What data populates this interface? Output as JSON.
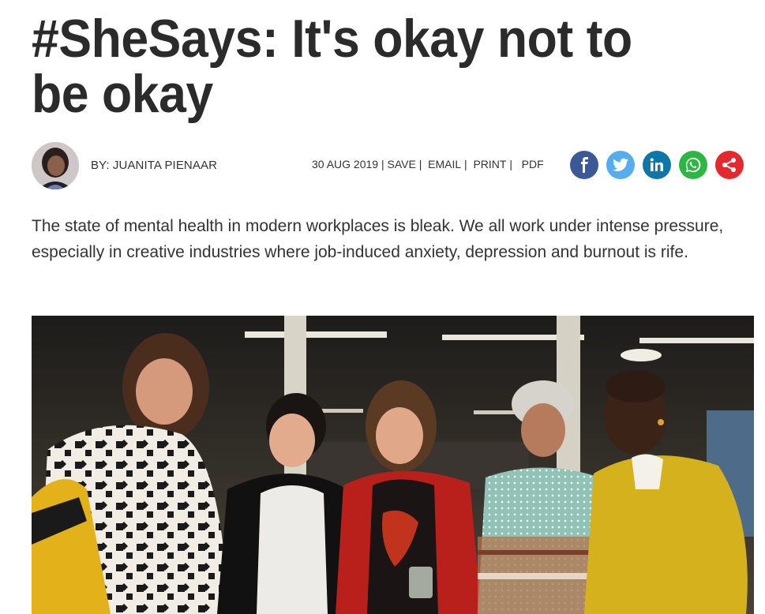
{
  "article": {
    "headline": "#SheSays: It's okay not to be okay",
    "author": "BY: JUANITA PIENAAR",
    "date": "30 AUG 2019",
    "actions": {
      "save": "SAVE",
      "email": "EMAIL",
      "print": "PRINT",
      "pdf": "PDF"
    },
    "separator": "|",
    "intro": "The state of mental health in modern workplaces is bleak. We all work under intense pressure, especially in creative industries where job-induced anxiety, depression and burnout is rife."
  },
  "share": {
    "facebook": {
      "icon": "facebook-icon",
      "color": "#3b5998"
    },
    "twitter": {
      "icon": "twitter-icon",
      "color": "#55acee"
    },
    "linkedin": {
      "icon": "linkedin-icon",
      "color": "#0e76a8"
    },
    "whatsapp": {
      "icon": "whatsapp-icon",
      "color": "#2cb742"
    },
    "share": {
      "icon": "share-icon",
      "color": "#e3292e"
    }
  }
}
